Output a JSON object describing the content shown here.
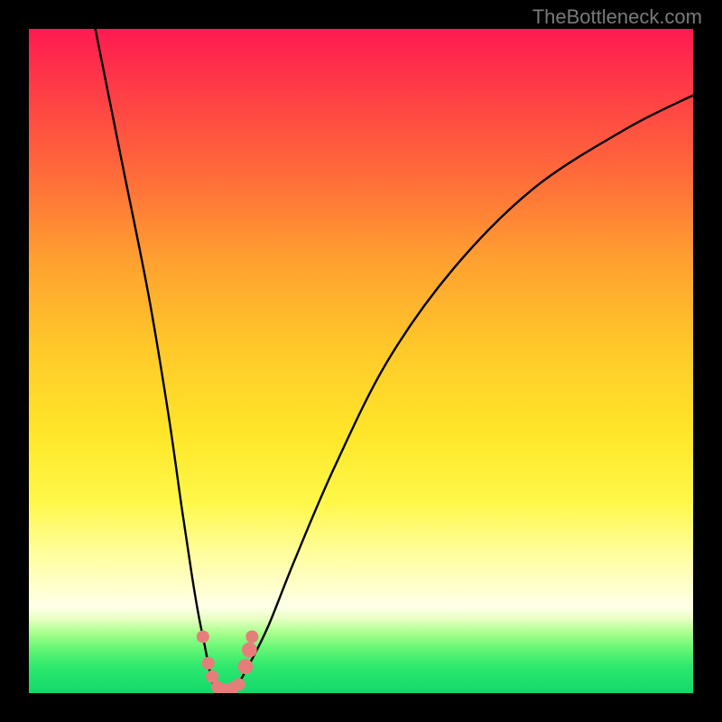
{
  "watermark": "TheBottleneck.com",
  "colors": {
    "frame": "#000000",
    "curve": "#000000",
    "markers": "#e77d7a",
    "watermark_text": "#7a7a7a"
  },
  "chart_data": {
    "type": "line",
    "title": "",
    "xlabel": "",
    "ylabel": "",
    "xlim": [
      0,
      100
    ],
    "ylim": [
      0,
      100
    ],
    "grid": false,
    "legend": false,
    "background_gradient": {
      "axis": "y",
      "stops": [
        {
          "y": 100,
          "color": "#ff1a51"
        },
        {
          "y": 50,
          "color": "#ffc82a"
        },
        {
          "y": 15,
          "color": "#fff84a"
        },
        {
          "y": 10,
          "color": "#ffffea"
        },
        {
          "y": 0,
          "color": "#12d86a"
        }
      ]
    },
    "series": [
      {
        "name": "left-branch",
        "x": [
          10,
          14,
          18,
          21,
          23,
          24.5,
          25.5,
          26.5,
          27.3,
          28
        ],
        "y": [
          100,
          80,
          60,
          42,
          28,
          18,
          12,
          7,
          3,
          0.5
        ]
      },
      {
        "name": "right-branch",
        "x": [
          31,
          33,
          36,
          40,
          46,
          54,
          64,
          76,
          90,
          100
        ],
        "y": [
          0.5,
          4,
          10,
          20,
          34,
          50,
          64,
          76,
          85,
          90
        ]
      },
      {
        "name": "floor",
        "x": [
          28,
          29.5,
          31
        ],
        "y": [
          0.5,
          0.2,
          0.5
        ]
      }
    ],
    "markers": [
      {
        "x": 26.2,
        "y": 8.5,
        "r": 1.0
      },
      {
        "x": 27.0,
        "y": 4.5,
        "r": 1.0
      },
      {
        "x": 27.6,
        "y": 2.5,
        "r": 1.0
      },
      {
        "x": 28.4,
        "y": 0.9,
        "r": 1.0
      },
      {
        "x": 29.5,
        "y": 0.5,
        "r": 1.0
      },
      {
        "x": 30.6,
        "y": 0.7,
        "r": 1.0
      },
      {
        "x": 31.6,
        "y": 1.3,
        "r": 1.0
      },
      {
        "x": 32.6,
        "y": 4.0,
        "r": 1.2
      },
      {
        "x": 33.2,
        "y": 6.5,
        "r": 1.2
      },
      {
        "x": 33.6,
        "y": 8.5,
        "r": 1.0
      }
    ]
  }
}
